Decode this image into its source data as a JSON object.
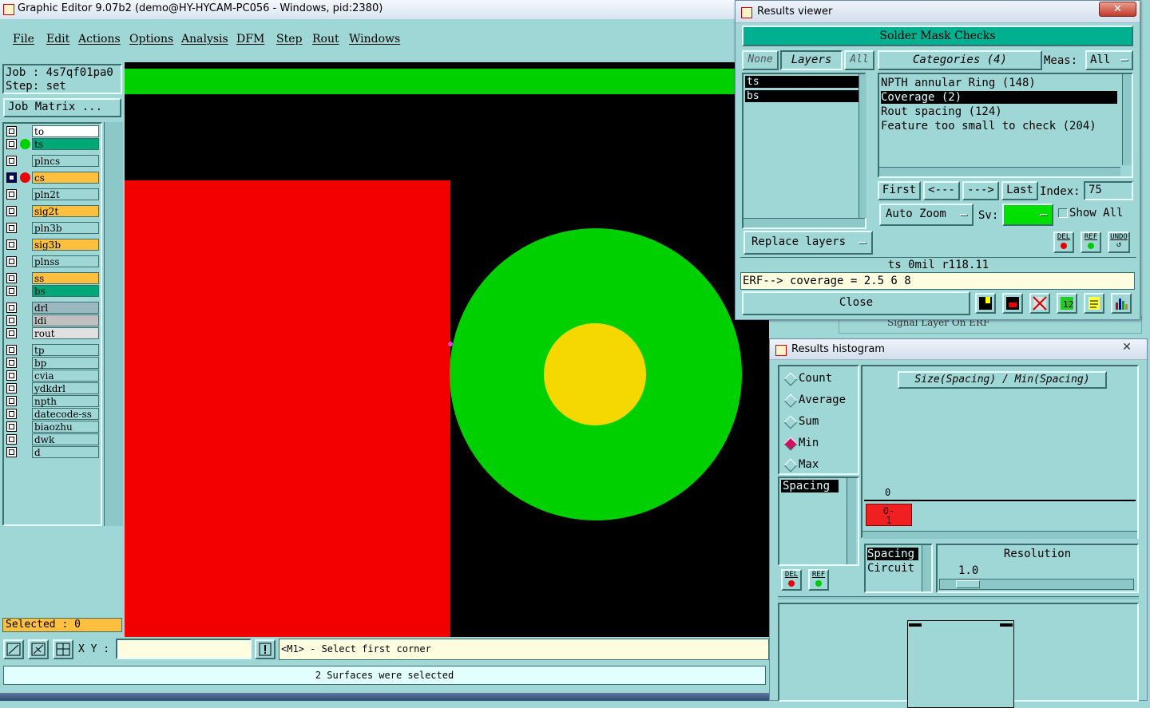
{
  "app": {
    "title": "Graphic Editor 9.07b2 (demo@HY-HYCAM-PC056 - Windows, pid:2380)",
    "menu": [
      "File",
      "Edit",
      "Actions",
      "Options",
      "Analysis",
      "DFM",
      "Step",
      "Rout",
      "Windows"
    ]
  },
  "job": {
    "job_line": "Job : 4s7qf01pa0",
    "step_line": "Step: set",
    "matrix_button": "Job Matrix ..."
  },
  "layers": [
    {
      "name": "to",
      "color": "#ffffff"
    },
    {
      "name": "ts",
      "color": "#00a878"
    },
    {
      "name": "plncs",
      "color": "#9fd6d6"
    },
    {
      "name": "cs",
      "color": "#ffc040"
    },
    {
      "name": "pln2t",
      "color": "#9fd6d6"
    },
    {
      "name": "sig2t",
      "color": "#ffc040"
    },
    {
      "name": "pln3b",
      "color": "#9fd6d6"
    },
    {
      "name": "sig3b",
      "color": "#ffc040"
    },
    {
      "name": "plnss",
      "color": "#9fd6d6"
    },
    {
      "name": "ss",
      "color": "#ffc040"
    },
    {
      "name": "bs",
      "color": "#00a878"
    },
    {
      "name": "drl",
      "color": "#9ab8c0"
    },
    {
      "name": "ldi",
      "color": "#c0c0c0"
    },
    {
      "name": "rout",
      "color": "#e0e0e0"
    },
    {
      "name": "tp",
      "color": "#9fd6d6"
    },
    {
      "name": "bp",
      "color": "#9fd6d6"
    },
    {
      "name": "cvia",
      "color": "#9fd6d6"
    },
    {
      "name": "ydkdrl",
      "color": "#9fd6d6"
    },
    {
      "name": "npth",
      "color": "#9fd6d6"
    },
    {
      "name": "datecode-ss",
      "color": "#9fd6d6"
    },
    {
      "name": "biaozhu",
      "color": "#9fd6d6"
    },
    {
      "name": "dwk",
      "color": "#9fd6d6"
    },
    {
      "name": "d",
      "color": "#9fd6d6"
    }
  ],
  "selected": "Selected : 0",
  "bottom": {
    "xy_label": "X Y :",
    "prompt": "<M1> - Select first corner",
    "status": "2 Surfaces were selected"
  },
  "results_viewer": {
    "title": "Results viewer",
    "header": "Solder Mask Checks",
    "btn_none": "None",
    "btn_layers": "Layers",
    "btn_all": "All",
    "layers": [
      "ts",
      "bs"
    ],
    "categories_label": "Categories (4)",
    "meas_label": "Meas:",
    "meas_value": "All",
    "categories": [
      "NPTH annular Ring (148)",
      "Coverage (2)",
      "Rout spacing (124)",
      "Feature too small to check (204)"
    ],
    "nav": {
      "first": "First",
      "prev": "<---",
      "next": "--->",
      "last": "Last",
      "index_label": "Index:",
      "index_value": "75"
    },
    "auto_zoom": "Auto Zoom",
    "sv_label": "Sv:",
    "show_all": "Show All",
    "replace_layers": "Replace layers",
    "small_btns": [
      "DEL",
      "REF",
      "UNDO"
    ],
    "info_line": "ts 0mil  r118.11",
    "erf_line": "ERF--> coverage = 2.5 6 8",
    "close": "Close"
  },
  "histogram": {
    "title": "Results histogram",
    "options": [
      "Count",
      "Average",
      "Sum",
      "Min",
      "Max"
    ],
    "selected_option": "Min",
    "list_item": "Spacing",
    "chart_title": "Size(Spacing) / Min(Spacing)",
    "bar_count": "0",
    "bar_label": "0-\n1",
    "measures": [
      "Spacing",
      "Circuit"
    ],
    "resolution_label": "Resolution",
    "resolution_value": "1.0",
    "small_btns": [
      "DEL",
      "REF"
    ]
  },
  "hidden_window_text": "Signal Layer On ERF"
}
